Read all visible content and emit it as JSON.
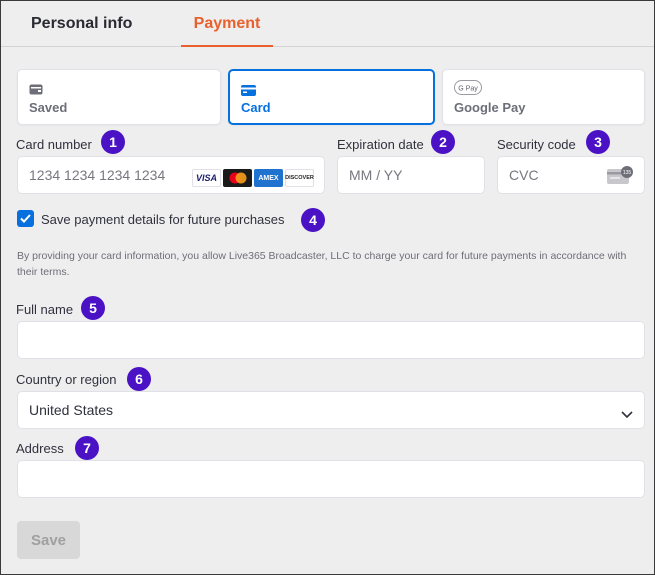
{
  "tabs": {
    "personal": "Personal info",
    "payment": "Payment"
  },
  "methods": {
    "saved": "Saved",
    "card": "Card",
    "google_pay": "Google Pay",
    "gpay_icon_text": "G Pay"
  },
  "fields": {
    "card_number": {
      "label": "Card number",
      "placeholder": "1234 1234 1234 1234",
      "badge": "1"
    },
    "expiration": {
      "label": "Expiration date",
      "placeholder": "MM / YY",
      "badge": "2"
    },
    "security": {
      "label": "Security code",
      "placeholder": "CVC",
      "badge": "3",
      "cvc_icon_text": "135"
    },
    "full_name": {
      "label": "Full name",
      "value": "",
      "badge": "5"
    },
    "country": {
      "label": "Country or region",
      "value": "United States",
      "badge": "6"
    },
    "address": {
      "label": "Address",
      "value": "",
      "badge": "7"
    }
  },
  "card_brands": [
    "VISA",
    "Mastercard",
    "AMEX",
    "DISCOVER"
  ],
  "save_details": {
    "label": "Save payment details for future purchases",
    "checked": true,
    "badge": "4"
  },
  "terms": "By providing your card information, you allow Live365 Broadcaster, LLC to charge your card for future payments in accordance with their terms.",
  "save_button": "Save",
  "colors": {
    "accent_orange": "#e8602c",
    "selected_blue": "#0570de",
    "badge_purple": "#4a12c4"
  }
}
